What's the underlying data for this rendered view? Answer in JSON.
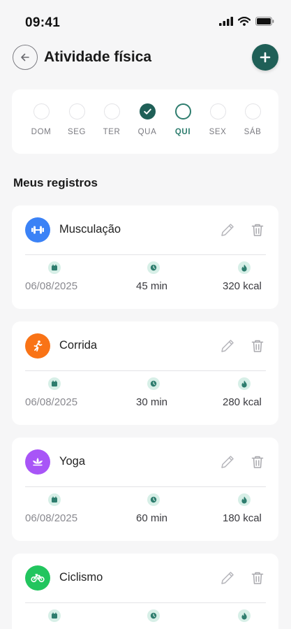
{
  "status": {
    "time": "09:41"
  },
  "header": {
    "title": "Atividade física"
  },
  "week": [
    {
      "label": "DOM",
      "state": "empty"
    },
    {
      "label": "SEG",
      "state": "empty"
    },
    {
      "label": "TER",
      "state": "empty"
    },
    {
      "label": "QUA",
      "state": "checked"
    },
    {
      "label": "QUI",
      "state": "today"
    },
    {
      "label": "SEX",
      "state": "empty"
    },
    {
      "label": "SÁB",
      "state": "empty"
    }
  ],
  "section_title": "Meus registros",
  "records": [
    {
      "name": "Musculação",
      "icon": "dumbbell-icon",
      "color": "#3b82f6",
      "date": "06/08/2025",
      "duration": "45 min",
      "kcal": "320 kcal"
    },
    {
      "name": "Corrida",
      "icon": "running-icon",
      "color": "#f97316",
      "date": "06/08/2025",
      "duration": "30 min",
      "kcal": "280 kcal"
    },
    {
      "name": "Yoga",
      "icon": "lotus-icon",
      "color": "#a855f7",
      "date": "06/08/2025",
      "duration": "60 min",
      "kcal": "180 kcal"
    },
    {
      "name": "Ciclismo",
      "icon": "bicycle-icon",
      "color": "#22c55e"
    }
  ],
  "colors": {
    "accent": "#1f5f57",
    "meta_icon_bg": "#d7efe7",
    "meta_icon_fg": "#2e7d6e"
  }
}
